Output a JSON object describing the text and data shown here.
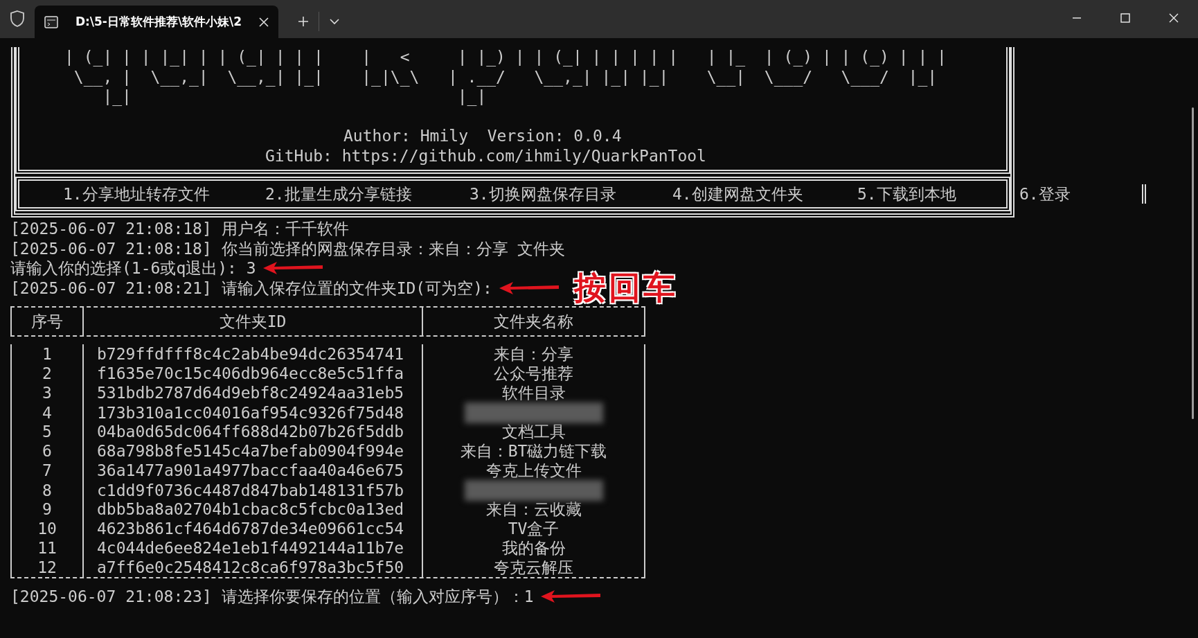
{
  "window": {
    "tab_title": "D:\\5-日常软件推荐\\软件小妹\\2"
  },
  "banner": {
    "art_lines": [
      "| (_| | | |_| | | (_| | | |    |   <     | |_) | | (_| | | | | |   | |_  | (_) | | (_) | | |",
      " \\__, |  \\__,_|  \\__,_| |_|    |_|\\_\\   | .__/   \\__,_| |_| |_|    \\__|  \\___/   \\___/  |_|",
      "    |_|                                  |_|"
    ],
    "author_line": "Author: Hmily  Version: 0.0.4",
    "github_line": "GitHub: https://github.com/ihmily/QuarkPanTool"
  },
  "menu": [
    "1.分享地址转存文件",
    "2.批量生成分享链接",
    "3.切换网盘保存目录",
    "4.创建网盘文件夹",
    "5.下载到本地",
    "6.登录"
  ],
  "log_before": [
    {
      "text": "[2025-06-07 21:08:18] 用户名：千千软件",
      "arrow": false
    },
    {
      "text": "[2025-06-07 21:08:18] 你当前选择的网盘保存目录：来自：分享 文件夹",
      "arrow": false
    },
    {
      "text": "请输入你的选择(1-6或q退出): 3",
      "arrow": true
    },
    {
      "text": "[2025-06-07 21:08:21] 请输入保存位置的文件夹ID(可为空):",
      "arrow": true,
      "note": "按回车"
    }
  ],
  "table": {
    "columns": [
      "序号",
      "文件夹ID",
      "文件夹名称"
    ],
    "rows": [
      {
        "index": "1",
        "id": "b729ffdfff8c4c2ab4be94dc26354741",
        "name": "来自：分享",
        "blurred": false
      },
      {
        "index": "2",
        "id": "f1635e70c15c406db964ecc8e5c51ffa",
        "name": "公众号推荐",
        "blurred": false
      },
      {
        "index": "3",
        "id": "531bdb2787d64d9ebf8c24924aa31eb5",
        "name": "软件目录",
        "blurred": false
      },
      {
        "index": "4",
        "id": "173b310a1cc04016af954c9326f75d48",
        "blurred": true
      },
      {
        "index": "5",
        "id": "04ba0d65dc064ff688d42b07b26f5ddb",
        "name": "文档工具",
        "blurred": false
      },
      {
        "index": "6",
        "id": "68a798b8fe5145c4a7befab0904f994e",
        "name": "来自：BT磁力链下载",
        "blurred": false
      },
      {
        "index": "7",
        "id": "36a1477a901a4977baccfaa40a46e675",
        "name": "夸克上传文件",
        "blurred": false
      },
      {
        "index": "8",
        "id": "c1dd9f0736c4487d847bab148131f57b",
        "blurred": true
      },
      {
        "index": "9",
        "id": "dbb5ba8a02704b1cbac8c5fcbc0a13ed",
        "name": "来自：云收藏",
        "blurred": false
      },
      {
        "index": "10",
        "id": "4623b861cf464d6787de34e09661cc54",
        "name": "TV盒子",
        "blurred": false
      },
      {
        "index": "11",
        "id": "4c044de6ee824e1eb1f4492144a11b7e",
        "name": "我的备份",
        "blurred": false
      },
      {
        "index": "12",
        "id": "a7ff6e0c2548412c8ca6f978a3bc5f50",
        "name": "夸克云解压",
        "blurred": false
      }
    ]
  },
  "log_after": [
    {
      "text": "[2025-06-07 21:08:23] 请选择你要保存的位置（输入对应序号）：1",
      "arrow": true
    }
  ]
}
